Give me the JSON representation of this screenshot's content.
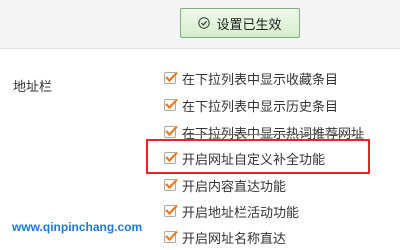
{
  "header": {
    "status_button_label": "设置已生效",
    "status_icon": "check-circle-icon"
  },
  "section": {
    "label": "地址栏"
  },
  "options": [
    {
      "label": "在下拉列表中显示收藏条目",
      "checked": true
    },
    {
      "label": "在下拉列表中显示历史条目",
      "checked": true
    },
    {
      "label": "在下拉列表中显示热词推荐网址",
      "checked": true
    },
    {
      "label": "开启网址自定义补全功能",
      "checked": true
    },
    {
      "label": "开启内容直达功能",
      "checked": true
    },
    {
      "label": "开启地址栏活动功能",
      "checked": true
    },
    {
      "label": "开启网址名称直达",
      "checked": true
    }
  ],
  "watermark": "www.qinpinchang.com",
  "colors": {
    "checkmark": "#f07a1a",
    "highlight_border": "#e8232a",
    "watermark": "#1a7ad6"
  }
}
